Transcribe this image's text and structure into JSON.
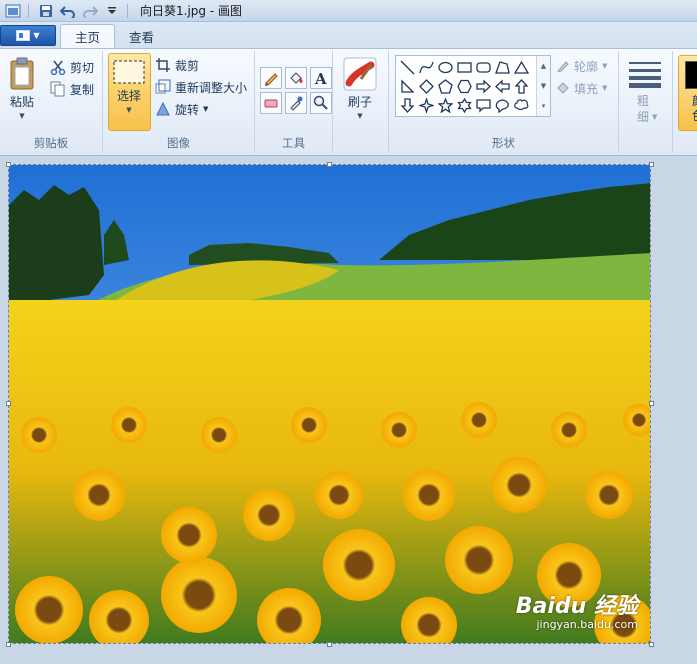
{
  "window": {
    "title": "向日葵1.jpg - 画图"
  },
  "quick_access": {
    "items": [
      "save-icon",
      "undo-icon",
      "redo-icon",
      "customize-icon"
    ]
  },
  "tabs": [
    {
      "label": "主页",
      "active": true
    },
    {
      "label": "查看",
      "active": false
    }
  ],
  "ribbon": {
    "clipboard": {
      "label": "剪贴板",
      "paste": "粘贴",
      "cut": "剪切",
      "copy": "复制"
    },
    "image": {
      "label": "图像",
      "select": "选择",
      "crop": "裁剪",
      "resize": "重新调整大小",
      "rotate": "旋转"
    },
    "tools": {
      "label": "工具"
    },
    "brushes": {
      "label": "刷子"
    },
    "shapes": {
      "label": "形状",
      "outline": "轮廓",
      "fill": "填充"
    },
    "size": {
      "label": "粗细"
    },
    "colors": {
      "label": "颜色"
    }
  },
  "canvas": {
    "image_name": "向日葵1.jpg"
  },
  "watermark": {
    "main": "Baidu 经验",
    "sub": "jingyan.baidu.com"
  },
  "colors": {
    "accent": "#fbd16a",
    "ribbon_bg": "#e9f0f9",
    "canvas_bg": "#c9d6e6"
  }
}
